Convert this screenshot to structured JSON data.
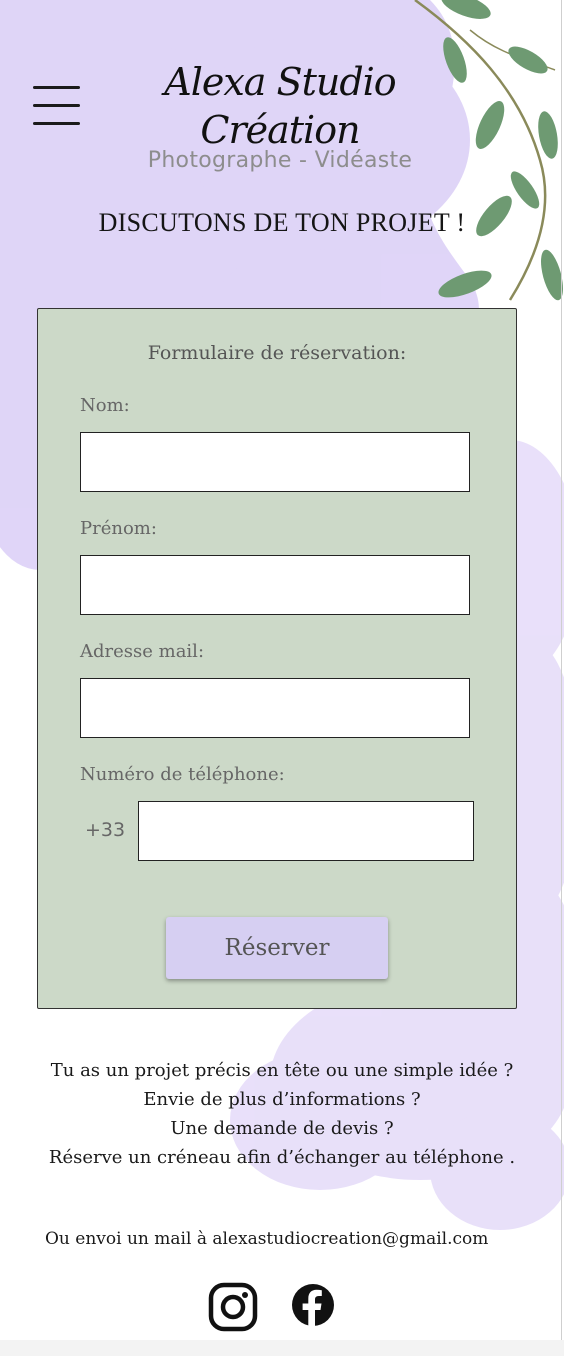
{
  "header": {
    "menu_icon": "hamburger-menu-icon",
    "brand_title": "Alexa Studio Création",
    "brand_subtitle": "Photographe - Vidéaste"
  },
  "page_heading": "DISCUTONS DE TON PROJET !",
  "form": {
    "title": "Formulaire de réservation:",
    "fields": [
      {
        "label": "Nom:",
        "value": "",
        "placeholder": ""
      },
      {
        "label": "Prénom:",
        "value": "",
        "placeholder": ""
      },
      {
        "label": "Adresse mail:",
        "value": "",
        "placeholder": ""
      },
      {
        "label": "Numéro de téléphone:",
        "prefix": "+33",
        "value": "",
        "placeholder": ""
      }
    ],
    "submit_label": "Réserver"
  },
  "info_lines": [
    "Tu as un projet précis en tête ou une simple idée ?",
    "Envie de plus d’informations ?",
    "Une demande de devis ?",
    "Réserve un créneau afin d’échanger au téléphone ."
  ],
  "mail_line": "Ou envoi  un mail à alexastudiocreation@gmail.com",
  "social": [
    {
      "icon": "instagram-icon"
    },
    {
      "icon": "facebook-icon"
    }
  ],
  "colors": {
    "watercolor": "#d6c8f5",
    "form_background": "#ccd9c8",
    "button": "#d6cff2",
    "leaf": "#6e9a72"
  }
}
